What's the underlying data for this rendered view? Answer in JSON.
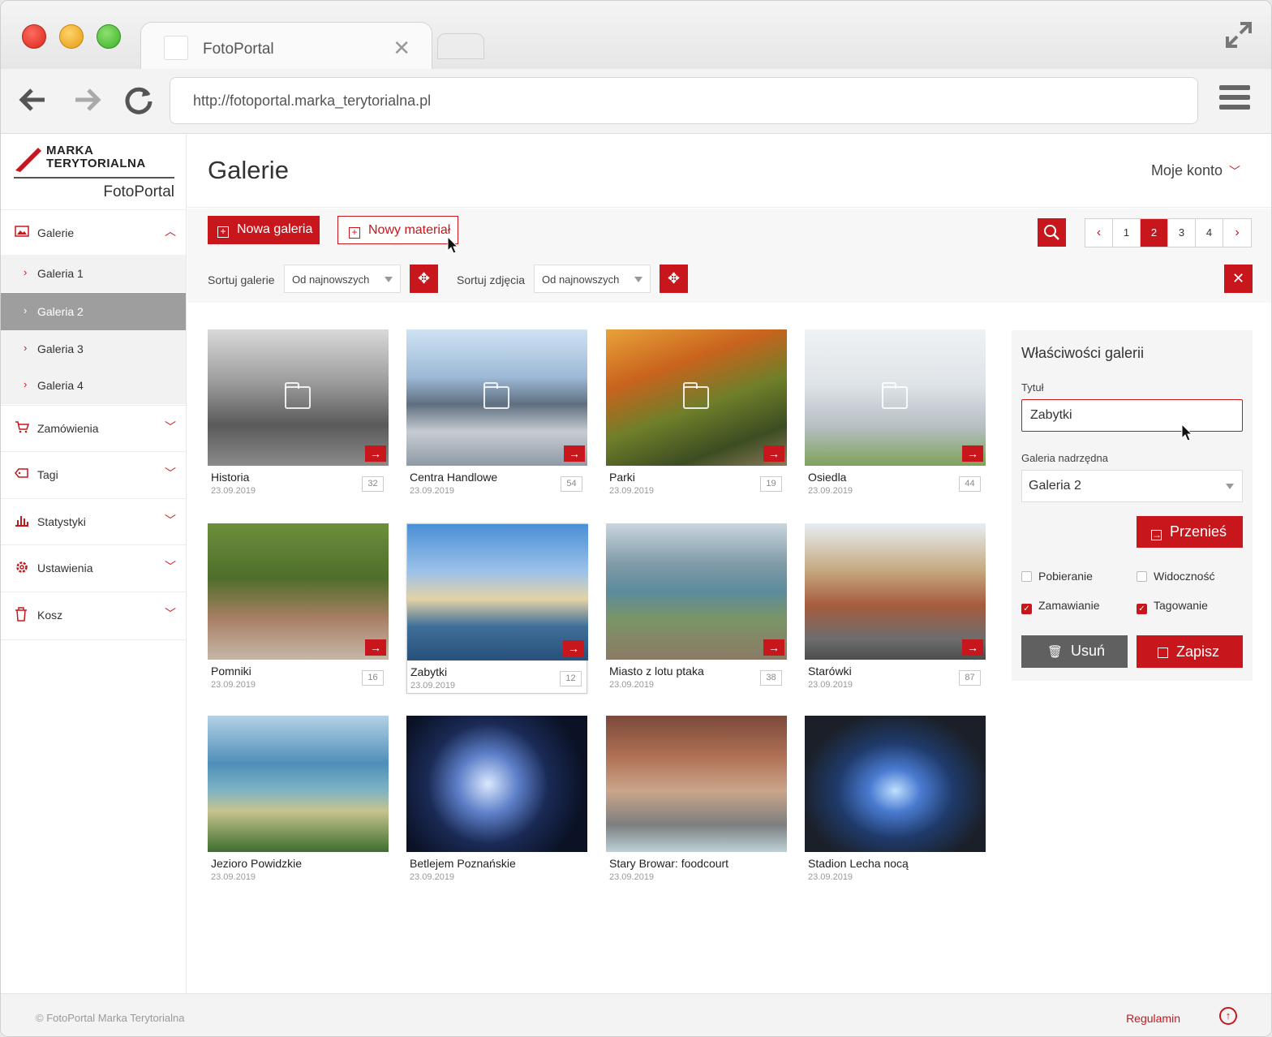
{
  "browser": {
    "tab_title": "FotoPortal",
    "url": "http://fotoportal.marka_terytorialna.pl"
  },
  "logo": {
    "line1": "MARKA",
    "line2": "TERYTORIALNA",
    "subtitle": "FotoPortal"
  },
  "sidebar": {
    "galleries_label": "Galerie",
    "sub_items": [
      "Galeria 1",
      "Galeria 2",
      "Galeria 3",
      "Galeria 4"
    ],
    "active_sub": "Galeria 2",
    "items": [
      {
        "label": "Zamówienia",
        "icon": "cart-icon"
      },
      {
        "label": "Tagi",
        "icon": "tag-icon"
      },
      {
        "label": "Statystyki",
        "icon": "bar-chart-icon"
      },
      {
        "label": "Ustawienia",
        "icon": "gear-icon"
      },
      {
        "label": "Kosz",
        "icon": "trash-icon"
      }
    ]
  },
  "header": {
    "title": "Galerie",
    "account": "Moje konto"
  },
  "toolbar": {
    "new_gallery": "Nowa galeria",
    "new_material": "Nowy materiał",
    "sort_galleries_label": "Sortuj galerie",
    "sort_galleries_value": "Od najnowszych",
    "sort_photos_label": "Sortuj zdjęcia",
    "sort_photos_value": "Od najnowszych",
    "pages": [
      "1",
      "2",
      "3",
      "4"
    ],
    "current_page": "2"
  },
  "galleries": [
    {
      "name": "Historia",
      "date": "23.09.2019",
      "count": "32"
    },
    {
      "name": "Centra Handlowe",
      "date": "23.09.2019",
      "count": "54"
    },
    {
      "name": "Parki",
      "date": "23.09.2019",
      "count": "19"
    },
    {
      "name": "Osiedla",
      "date": "23.09.2019",
      "count": "44"
    },
    {
      "name": "Pomniki",
      "date": "23.09.2019",
      "count": "16"
    },
    {
      "name": "Zabytki",
      "date": "23.09.2019",
      "count": "12"
    },
    {
      "name": "Miasto z lotu ptaka",
      "date": "23.09.2019",
      "count": "38"
    },
    {
      "name": "Starówki",
      "date": "23.09.2019",
      "count": "87"
    },
    {
      "name": "Jezioro Powidzkie",
      "date": "23.09.2019",
      "count": ""
    },
    {
      "name": "Betlejem Poznańskie",
      "date": "23.09.2019",
      "count": ""
    },
    {
      "name": "Stary Browar: foodcourt",
      "date": "23.09.2019",
      "count": ""
    },
    {
      "name": "Stadion Lecha nocą",
      "date": "23.09.2019",
      "count": ""
    }
  ],
  "panel": {
    "title": "Właściwości galerii",
    "title_label": "Tytuł",
    "title_value": "Zabytki",
    "parent_label": "Galeria nadrzędna",
    "parent_value": "Galeria 2",
    "move_button": "Przenieś",
    "checkboxes": [
      {
        "label": "Pobieranie",
        "checked": false
      },
      {
        "label": "Widoczność",
        "checked": false
      },
      {
        "label": "Zamawianie",
        "checked": true
      },
      {
        "label": "Tagowanie",
        "checked": true
      }
    ],
    "delete_button": "Usuń",
    "save_button": "Zapisz"
  },
  "footer": {
    "copyright": "© FotoPortal Marka Terytorialna",
    "terms": "Regulamin"
  },
  "colors": {
    "accent": "#c8161d"
  }
}
